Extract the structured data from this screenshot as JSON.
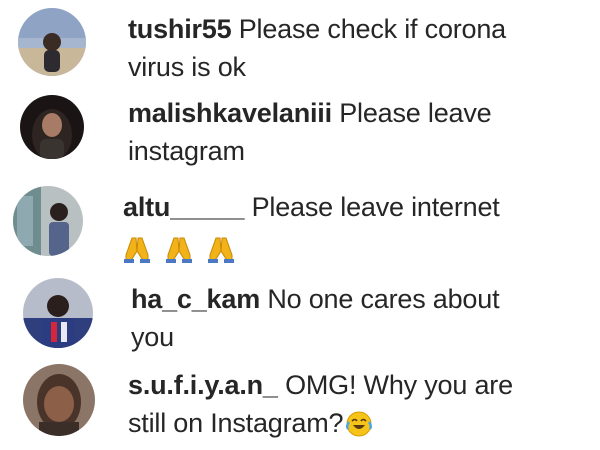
{
  "comments": [
    {
      "username": "tushir55",
      "line1": "Please check if corona",
      "line2": "virus is ok",
      "avatar_icon": "profile-photo",
      "accent": "#7a8aa6"
    },
    {
      "username": "malishkavelaniii",
      "line1": "Please leave",
      "line2": "instagram",
      "avatar_icon": "profile-photo",
      "accent": "#2b2320"
    },
    {
      "username": "altu_____",
      "line1": "Please leave internet",
      "emoji": [
        "folded-hands-icon",
        "folded-hands-icon",
        "folded-hands-icon"
      ],
      "avatar_icon": "profile-photo",
      "accent": "#9aa1a6"
    },
    {
      "username": "ha_c_kam",
      "line1": "No one cares about",
      "line2": "you",
      "avatar_icon": "profile-photo",
      "accent": "#3b4a7a"
    },
    {
      "username": "s.u.f.i.y.a.n_",
      "line1": "OMG! Why you are",
      "line2": "still on Instagram?",
      "emoji_trailing": "face-with-tears-of-joy-icon",
      "avatar_icon": "profile-photo",
      "accent": "#6d5546"
    }
  ]
}
